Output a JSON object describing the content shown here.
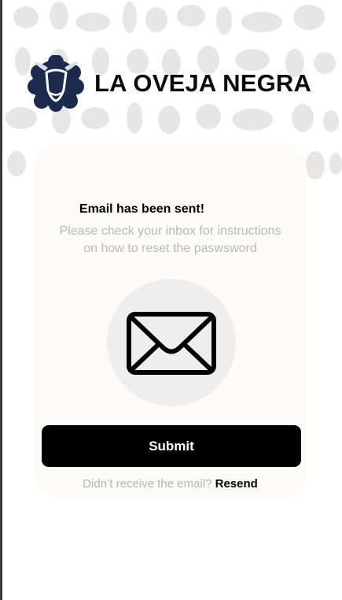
{
  "header": {
    "brand": "LA OVEJA NEGRA",
    "logo_icon": "sheep-logo-icon"
  },
  "card": {
    "title": "Email has been sent!",
    "subtitle_line1": "Please check your inbox for instructions",
    "subtitle_line2": "on how to reset the paswsword",
    "icon": "envelope-icon",
    "submit_label": "Submit",
    "resend_prompt": "Didn’t receive the email?",
    "resend_link": "Resend"
  },
  "colors": {
    "primary": "#000000",
    "logo": "#1c2b4d",
    "muted_text": "#b9b9b9",
    "card_bg": "#fcfbfa",
    "circle_bg": "#eeeeee"
  }
}
